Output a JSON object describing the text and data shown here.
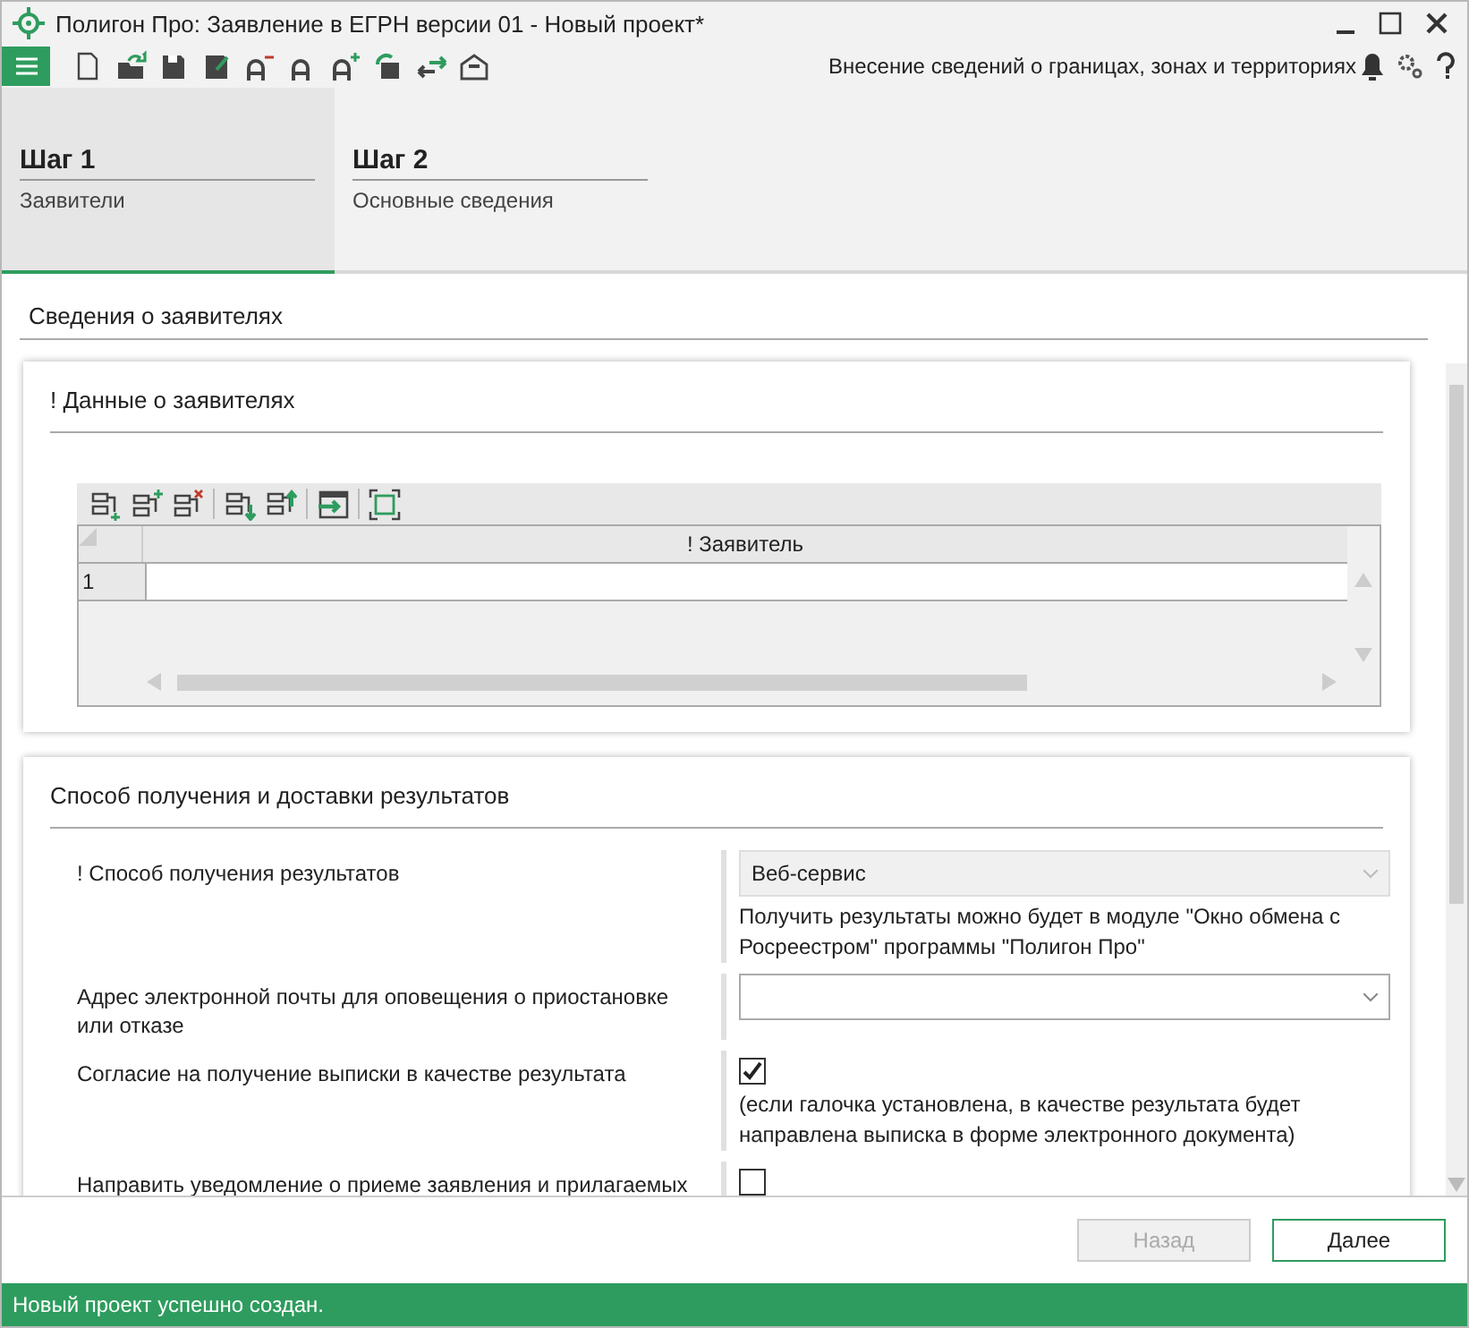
{
  "window": {
    "title": "Полигон Про: Заявление в ЕГРН версии 01 - Новый проект*"
  },
  "toolbar": {
    "module": "Внесение сведений о границах, зонах и территориях"
  },
  "steps": [
    {
      "title": "Шаг 1",
      "subtitle": "Заявители",
      "selected": true
    },
    {
      "title": "Шаг 2",
      "subtitle": "Основные сведения",
      "selected": false
    }
  ],
  "section_title": "Сведения о заявителях",
  "applicants_panel": {
    "title": "! Данные о заявителях",
    "table": {
      "columns": [
        "! Заявитель"
      ],
      "rows": [
        {
          "number": "1"
        }
      ]
    }
  },
  "delivery_panel": {
    "title": "Способ получения и доставки результатов",
    "fields": [
      {
        "kind": "select",
        "label": "! Способ получения результатов",
        "value": "Веб-сервис",
        "disabled": true,
        "hint": "Получить результаты можно будет в модуле \"Окно обмена с Росреестром\" программы \"Полигон Про\""
      },
      {
        "kind": "select",
        "label": "Адрес электронной почты для оповещения о приостановке или отказе",
        "disabled": false
      },
      {
        "kind": "checkbox",
        "label": "Согласие на получение выписки в качестве результата",
        "checked": true,
        "hint": "(если галочка установлена, в качестве результата будет направлена выписка в форме электронного документа)"
      },
      {
        "kind": "checkbox",
        "label": "Направить уведомление о приеме заявления и прилагаемых",
        "checked": false
      }
    ]
  },
  "buttons": [
    {
      "label": "Назад",
      "disabled": true
    },
    {
      "label": "Далее",
      "disabled": false
    }
  ],
  "status_bar": "Новый проект успешно создан."
}
